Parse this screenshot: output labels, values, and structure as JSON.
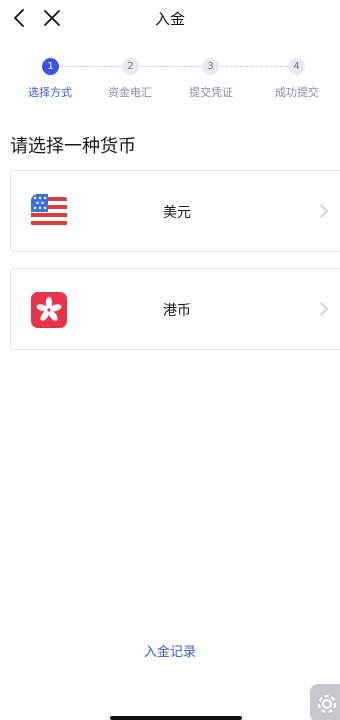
{
  "header": {
    "title": "入金"
  },
  "steps": [
    {
      "number": "1",
      "label": "选择方式",
      "active": true
    },
    {
      "number": "2",
      "label": "资金电汇",
      "active": false
    },
    {
      "number": "3",
      "label": "提交凭证",
      "active": false
    },
    {
      "number": "4",
      "label": "成功提交",
      "active": false
    }
  ],
  "heading": "请选择一种货币",
  "currencies": [
    {
      "label": "美元",
      "flag_icon": "us-flag-icon"
    },
    {
      "label": "港币",
      "flag_icon": "hk-flag-icon"
    }
  ],
  "footer": {
    "records_label": "入金记录"
  },
  "colors": {
    "accent": "#3d53e6",
    "hk_red": "#e8344a",
    "us_red": "#e03b3b",
    "us_blue": "#3f6fe0"
  }
}
